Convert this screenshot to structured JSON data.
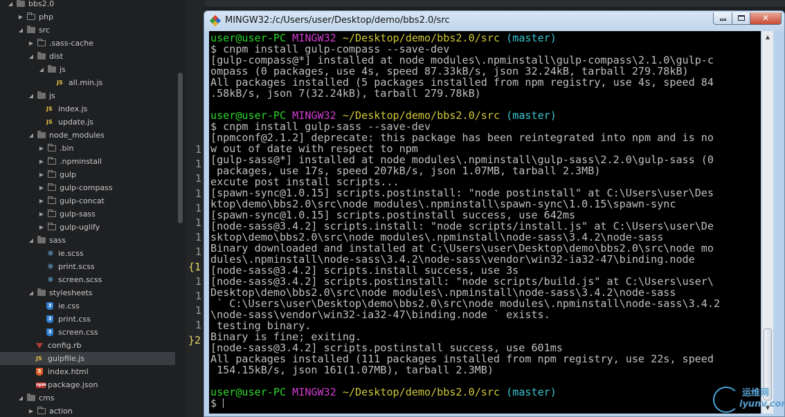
{
  "sidebar": {
    "tree": [
      {
        "label": "bbs2.0",
        "depth": 0,
        "kind": "folder",
        "open": true
      },
      {
        "label": "php",
        "depth": 1,
        "kind": "folder",
        "open": false
      },
      {
        "label": "src",
        "depth": 1,
        "kind": "folder",
        "open": true
      },
      {
        "label": ".sass-cache",
        "depth": 2,
        "kind": "folder",
        "open": false
      },
      {
        "label": "dist",
        "depth": 2,
        "kind": "folder",
        "open": true
      },
      {
        "label": "js",
        "depth": 3,
        "kind": "folder",
        "open": true
      },
      {
        "label": "all.min.js",
        "depth": 4,
        "kind": "js"
      },
      {
        "label": "js",
        "depth": 2,
        "kind": "folder",
        "open": true
      },
      {
        "label": "index.js",
        "depth": 3,
        "kind": "js"
      },
      {
        "label": "update.js",
        "depth": 3,
        "kind": "js"
      },
      {
        "label": "node_modules",
        "depth": 2,
        "kind": "folder",
        "open": true
      },
      {
        "label": ".bin",
        "depth": 3,
        "kind": "folder",
        "open": false
      },
      {
        "label": ".npminstall",
        "depth": 3,
        "kind": "folder",
        "open": false
      },
      {
        "label": "gulp",
        "depth": 3,
        "kind": "folder",
        "open": false
      },
      {
        "label": "gulp-compass",
        "depth": 3,
        "kind": "folder",
        "open": false
      },
      {
        "label": "gulp-concat",
        "depth": 3,
        "kind": "folder",
        "open": false
      },
      {
        "label": "gulp-sass",
        "depth": 3,
        "kind": "folder",
        "open": false
      },
      {
        "label": "gulp-uglify",
        "depth": 3,
        "kind": "folder",
        "open": false
      },
      {
        "label": "sass",
        "depth": 2,
        "kind": "folder",
        "open": true
      },
      {
        "label": "ie.scss",
        "depth": 3,
        "kind": "scss"
      },
      {
        "label": "print.scss",
        "depth": 3,
        "kind": "scss"
      },
      {
        "label": "screen.scss",
        "depth": 3,
        "kind": "scss"
      },
      {
        "label": "stylesheets",
        "depth": 2,
        "kind": "folder",
        "open": true
      },
      {
        "label": "ie.css",
        "depth": 3,
        "kind": "css"
      },
      {
        "label": "print.css",
        "depth": 3,
        "kind": "css"
      },
      {
        "label": "screen.css",
        "depth": 3,
        "kind": "css"
      },
      {
        "label": "config.rb",
        "depth": 2,
        "kind": "ruby"
      },
      {
        "label": "gulpfile.js",
        "depth": 2,
        "kind": "js",
        "selected": true
      },
      {
        "label": "index.html",
        "depth": 2,
        "kind": "html"
      },
      {
        "label": "package.json",
        "depth": 2,
        "kind": "npm"
      },
      {
        "label": "cms",
        "depth": 1,
        "kind": "folder",
        "open": true
      },
      {
        "label": "action",
        "depth": 2,
        "kind": "folder",
        "open": false
      }
    ],
    "icon_glyphs": {
      "js": "JS",
      "css": "3",
      "html": "5",
      "npm": "npm",
      "scss": "✺"
    }
  },
  "editor": {
    "gutter": [
      {
        "text": "1",
        "highlight": false
      },
      {
        "text": "1",
        "highlight": false
      },
      {
        "text": "1",
        "highlight": false
      },
      {
        "text": "1",
        "highlight": false
      },
      {
        "text": "1",
        "highlight": false
      },
      {
        "text": "1",
        "highlight": false
      },
      {
        "text": "1",
        "highlight": false
      },
      {
        "text": "1",
        "highlight": false
      },
      {
        "text": "{1",
        "highlight": true
      },
      {
        "text": "1",
        "highlight": false
      },
      {
        "text": "1",
        "highlight": false
      },
      {
        "text": "1",
        "highlight": false
      },
      {
        "text": "1",
        "highlight": false
      },
      {
        "text": "}2",
        "highlight": true
      }
    ]
  },
  "window": {
    "title": "MINGW32:/c/Users/user/Desktop/demo/bbs2.0/src",
    "minimize_label": "",
    "maximize_label": "",
    "close_label": "✕"
  },
  "colors": {
    "prompt_user": "#2bd92b",
    "prompt_sys": "#d23cd2",
    "prompt_path": "#d2c83a",
    "prompt_branch": "#3ac8d2",
    "terminal_text": "#c0c0c0"
  },
  "terminal": {
    "lines": [
      {
        "type": "prompt",
        "user": "user@user-PC",
        "sys": "MINGW32",
        "path": "~/Desktop/demo/bbs2.0/src",
        "branch": "(master)"
      },
      {
        "type": "text",
        "text": "$ cnpm install gulp-compass --save-dev"
      },
      {
        "type": "text",
        "text": "[gulp-compass@*] installed at node_modules\\.npminstall\\gulp-compass\\2.1.0\\gulp-c"
      },
      {
        "type": "text",
        "text": "ompass (0 packages, use 4s, speed 87.33kB/s, json 32.24kB, tarball 279.78kB)"
      },
      {
        "type": "text",
        "text": "All packages installed (5 packages installed from npm registry, use 4s, speed 84"
      },
      {
        "type": "text",
        "text": ".58kB/s, json 7(32.24kB), tarball 279.78kB)"
      },
      {
        "type": "text",
        "text": ""
      },
      {
        "type": "prompt",
        "user": "user@user-PC",
        "sys": "MINGW32",
        "path": "~/Desktop/demo/bbs2.0/src",
        "branch": "(master)"
      },
      {
        "type": "text",
        "text": "$ cnpm install gulp-sass --save-dev"
      },
      {
        "type": "text",
        "text": "[npmconf@2.1.2] deprecate: this package has been reintegrated into npm and is no"
      },
      {
        "type": "text",
        "text": "w out of date with respect to npm"
      },
      {
        "type": "text",
        "text": "[gulp-sass@*] installed at node_modules\\.npminstall\\gulp-sass\\2.2.0\\gulp-sass (0"
      },
      {
        "type": "text",
        "text": " packages, use 17s, speed 207kB/s, json 1.07MB, tarball 2.3MB)"
      },
      {
        "type": "text",
        "text": "excute post install scripts..."
      },
      {
        "type": "text",
        "text": "[spawn-sync@1.0.15] scripts.postinstall: \"node postinstall\" at C:\\Users\\user\\Des"
      },
      {
        "type": "text",
        "text": "ktop\\demo\\bbs2.0\\src\\node_modules\\.npminstall\\spawn-sync\\1.0.15\\spawn-sync"
      },
      {
        "type": "text",
        "text": "[spawn-sync@1.0.15] scripts.postinstall success, use 642ms"
      },
      {
        "type": "text",
        "text": "[node-sass@3.4.2] scripts.install: \"node scripts/install.js\" at C:\\Users\\user\\De"
      },
      {
        "type": "text",
        "text": "sktop\\demo\\bbs2.0\\src\\node_modules\\.npminstall\\node-sass\\3.4.2\\node-sass"
      },
      {
        "type": "text",
        "text": "Binary downloaded and installed at C:\\Users\\user\\Desktop\\demo\\bbs2.0\\src\\node_mo"
      },
      {
        "type": "text",
        "text": "dules\\.npminstall\\node-sass\\3.4.2\\node-sass\\vendor\\win32-ia32-47\\binding.node"
      },
      {
        "type": "text",
        "text": "[node-sass@3.4.2] scripts.install success, use 3s"
      },
      {
        "type": "text",
        "text": "[node-sass@3.4.2] scripts.postinstall: \"node scripts/build.js\" at C:\\Users\\user\\"
      },
      {
        "type": "text",
        "text": "Desktop\\demo\\bbs2.0\\src\\node_modules\\.npminstall\\node-sass\\3.4.2\\node-sass"
      },
      {
        "type": "text",
        "text": " ` C:\\Users\\user\\Desktop\\demo\\bbs2.0\\src\\node_modules\\.npminstall\\node-sass\\3.4.2"
      },
      {
        "type": "text",
        "text": "\\node-sass\\vendor\\win32-ia32-47\\binding.node ` exists."
      },
      {
        "type": "text",
        "text": " testing binary."
      },
      {
        "type": "text",
        "text": "Binary is fine; exiting."
      },
      {
        "type": "text",
        "text": "[node-sass@3.4.2] scripts.postinstall success, use 601ms"
      },
      {
        "type": "text",
        "text": "All packages installed (111 packages installed from npm registry, use 22s, speed"
      },
      {
        "type": "text",
        "text": " 154.15kB/s, json 161(1.07MB), tarball 2.3MB)"
      },
      {
        "type": "text",
        "text": ""
      },
      {
        "type": "prompt",
        "user": "user@user-PC",
        "sys": "MINGW32",
        "path": "~/Desktop/demo/bbs2.0/src",
        "branch": "(master)"
      },
      {
        "type": "input",
        "text": "$ "
      }
    ]
  },
  "scrollbar": {
    "up_icon": "▲",
    "down_icon": "▼"
  },
  "watermark": {
    "cn": "运维网",
    "url": "iyunv.com"
  }
}
